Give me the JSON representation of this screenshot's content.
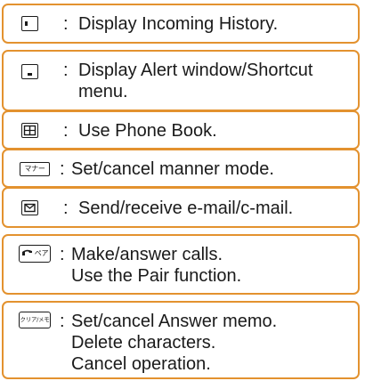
{
  "items": [
    {
      "icon": "left-key-icon",
      "icon_text": "",
      "lines": [
        "Display Incoming History."
      ]
    },
    {
      "icon": "down-key-icon",
      "icon_text": "",
      "lines": [
        "Display Alert window/Shortcut",
        "menu."
      ]
    },
    {
      "icon": "phone-book-icon",
      "icon_text": "",
      "lines": [
        "Use Phone Book."
      ]
    },
    {
      "icon": "manner-key-icon",
      "icon_text": "マナー",
      "lines": [
        "Set/cancel manner mode."
      ]
    },
    {
      "icon": "mail-key-icon",
      "icon_text": "",
      "lines": [
        "Send/receive e-mail/c-mail."
      ]
    },
    {
      "icon": "call-pair-key-icon",
      "icon_text": "ペア",
      "lines": [
        "Make/answer calls.",
        "Use the Pair function."
      ]
    },
    {
      "icon": "clear-memo-key-icon",
      "icon_text": "クリア/メモ",
      "lines": [
        "Set/cancel Answer memo.",
        "Delete characters.",
        "Cancel operation."
      ]
    }
  ],
  "colon": ":",
  "accent_color": "#e3922f"
}
